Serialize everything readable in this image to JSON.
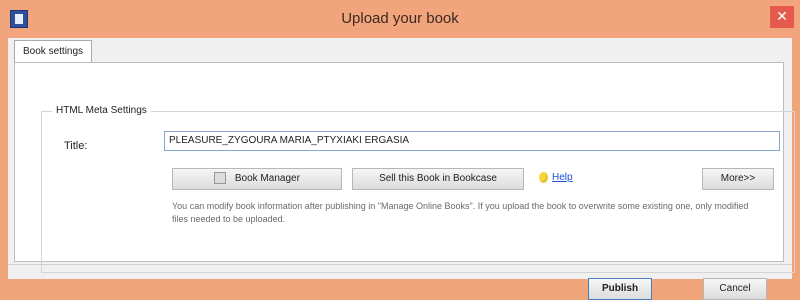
{
  "window": {
    "title": "Upload your book"
  },
  "tab": {
    "label": "Book settings"
  },
  "group": {
    "legend": "HTML Meta Settings"
  },
  "fields": {
    "title_label": "Title:",
    "title_value": "PLEASURE_ZYGOURA MARIA_PTYXIAKI ERGASIA"
  },
  "buttons": {
    "book_manager": "Book Manager",
    "sell_book": "Sell this Book in Bookcase",
    "help": "Help",
    "more": "More>>",
    "publish": "Publish",
    "cancel": "Cancel"
  },
  "description": "You can modify book information after publishing in \"Manage Online Books\". If you upload the book to overwrite some existing one, only modified files needed to be uploaded.",
  "colors": {
    "titlebar": "#f2a47c",
    "close": "#e45b4e",
    "accent": "#4a7fbf"
  }
}
